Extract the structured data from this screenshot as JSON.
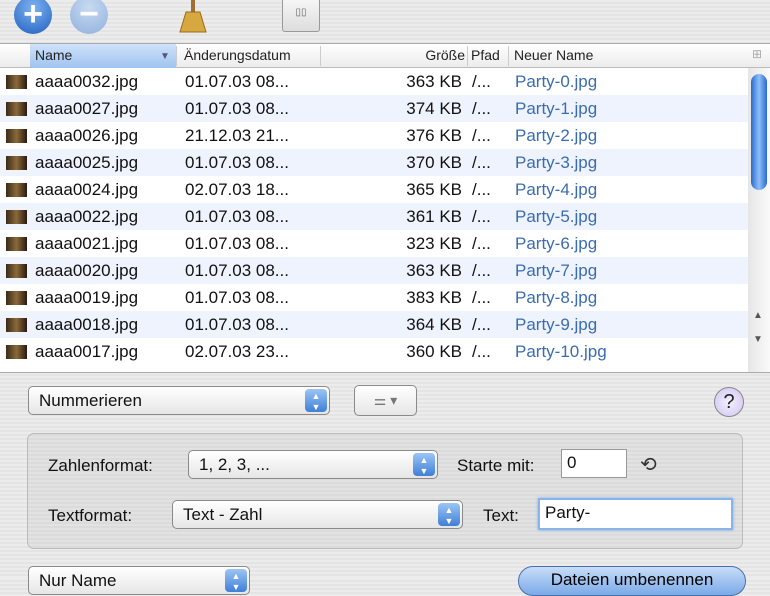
{
  "toolbar": {
    "add": "add-icon",
    "remove": "remove-icon",
    "clean": "broom-icon",
    "settings": "switches-icon"
  },
  "table": {
    "columns": [
      "Name",
      "Änderungsdatum",
      "Größe",
      "Pfad",
      "Neuer Name"
    ],
    "rows": [
      {
        "name": "aaaa0032.jpg",
        "date": "01.07.03 08...",
        "size": "363 KB",
        "path": "/...",
        "new": "Party-0.jpg"
      },
      {
        "name": "aaaa0027.jpg",
        "date": "01.07.03 08...",
        "size": "374 KB",
        "path": "/...",
        "new": "Party-1.jpg"
      },
      {
        "name": "aaaa0026.jpg",
        "date": "21.12.03 21...",
        "size": "376 KB",
        "path": "/...",
        "new": "Party-2.jpg"
      },
      {
        "name": "aaaa0025.jpg",
        "date": "01.07.03 08...",
        "size": "370 KB",
        "path": "/...",
        "new": "Party-3.jpg"
      },
      {
        "name": "aaaa0024.jpg",
        "date": "02.07.03 18...",
        "size": "365 KB",
        "path": "/...",
        "new": "Party-4.jpg"
      },
      {
        "name": "aaaa0022.jpg",
        "date": "01.07.03 08...",
        "size": "361 KB",
        "path": "/...",
        "new": "Party-5.jpg"
      },
      {
        "name": "aaaa0021.jpg",
        "date": "01.07.03 08...",
        "size": "323 KB",
        "path": "/...",
        "new": "Party-6.jpg"
      },
      {
        "name": "aaaa0020.jpg",
        "date": "01.07.03 08...",
        "size": "363 KB",
        "path": "/...",
        "new": "Party-7.jpg"
      },
      {
        "name": "aaaa0019.jpg",
        "date": "01.07.03 08...",
        "size": "383 KB",
        "path": "/...",
        "new": "Party-8.jpg"
      },
      {
        "name": "aaaa0018.jpg",
        "date": "01.07.03 08...",
        "size": "364 KB",
        "path": "/...",
        "new": "Party-9.jpg"
      },
      {
        "name": "aaaa0017.jpg",
        "date": "02.07.03 23...",
        "size": "360 KB",
        "path": "/...",
        "new": "Party-10.jpg"
      }
    ]
  },
  "mode": {
    "value": "Nummerieren",
    "help": "?"
  },
  "options": {
    "number_format_label": "Zahlenformat:",
    "number_format": "1, 2, 3, ...",
    "start_label": "Starte mit:",
    "start": "0",
    "text_format_label": "Textformat:",
    "text_format": "Text - Zahl",
    "text_label": "Text:",
    "text": "Party-"
  },
  "bottom": {
    "scope": "Nur Name",
    "rename": "Dateien umbenennen"
  }
}
